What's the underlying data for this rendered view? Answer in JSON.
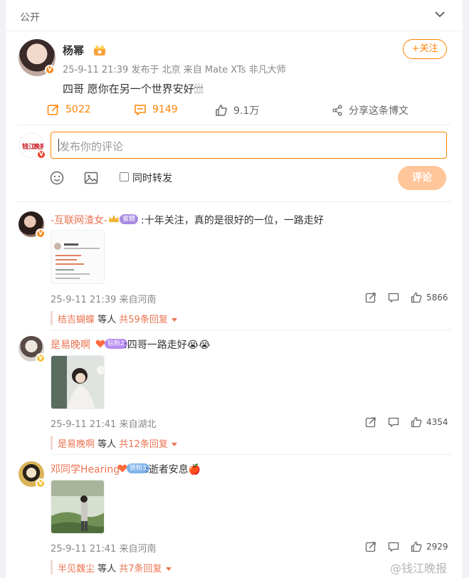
{
  "topbar": {
    "label": "公开"
  },
  "post": {
    "author": "杨幂",
    "meta": "25-9-11 21:39 发布于 北京 来自 Mate XTs 非凡大师",
    "text": "四哥 愿你在另一个世界安好🕯🕯🕯",
    "follow_label": "+关注",
    "repost_count": "5022",
    "comment_count": "9149",
    "like_count": "9.1万",
    "share_label": "分享这条博文"
  },
  "composer": {
    "placeholder": "发布你的评论",
    "repost_label": "同时转发",
    "submit_label": "评论"
  },
  "comments": [
    {
      "name": "-互联网渣女-",
      "level": "蜜糖",
      "text": ":十年关注，真的是很好的一位，一路走好",
      "time": "25-9-11 21:39 来自河南",
      "likes": "5866",
      "reply_user": "桔吉蝴蝶",
      "reply_mid": " 等人 ",
      "reply_count": "共59条回复"
    },
    {
      "name": "是易晚啊",
      "level": "钻粉2",
      "text": ":四哥一路走好😭😭",
      "time": "25-9-11 21:41 来自湖北",
      "likes": "4354",
      "reply_user": "是易晚啊",
      "reply_mid": " 等人 ",
      "reply_count": "共12条回复"
    },
    {
      "name": "邓同学Hearing",
      "level": "铁粉3",
      "text": ":逝者安息🍎",
      "time": "25-9-11 21:41 来自河南",
      "likes": "2929",
      "reply_user": "半见魏尘",
      "reply_mid": " 等人 ",
      "reply_count": "共7条回复"
    }
  ],
  "watermark": "@钱江晚报",
  "colors": {
    "accent": "#ff8200",
    "name": "#eb7350",
    "meta": "#888888"
  }
}
